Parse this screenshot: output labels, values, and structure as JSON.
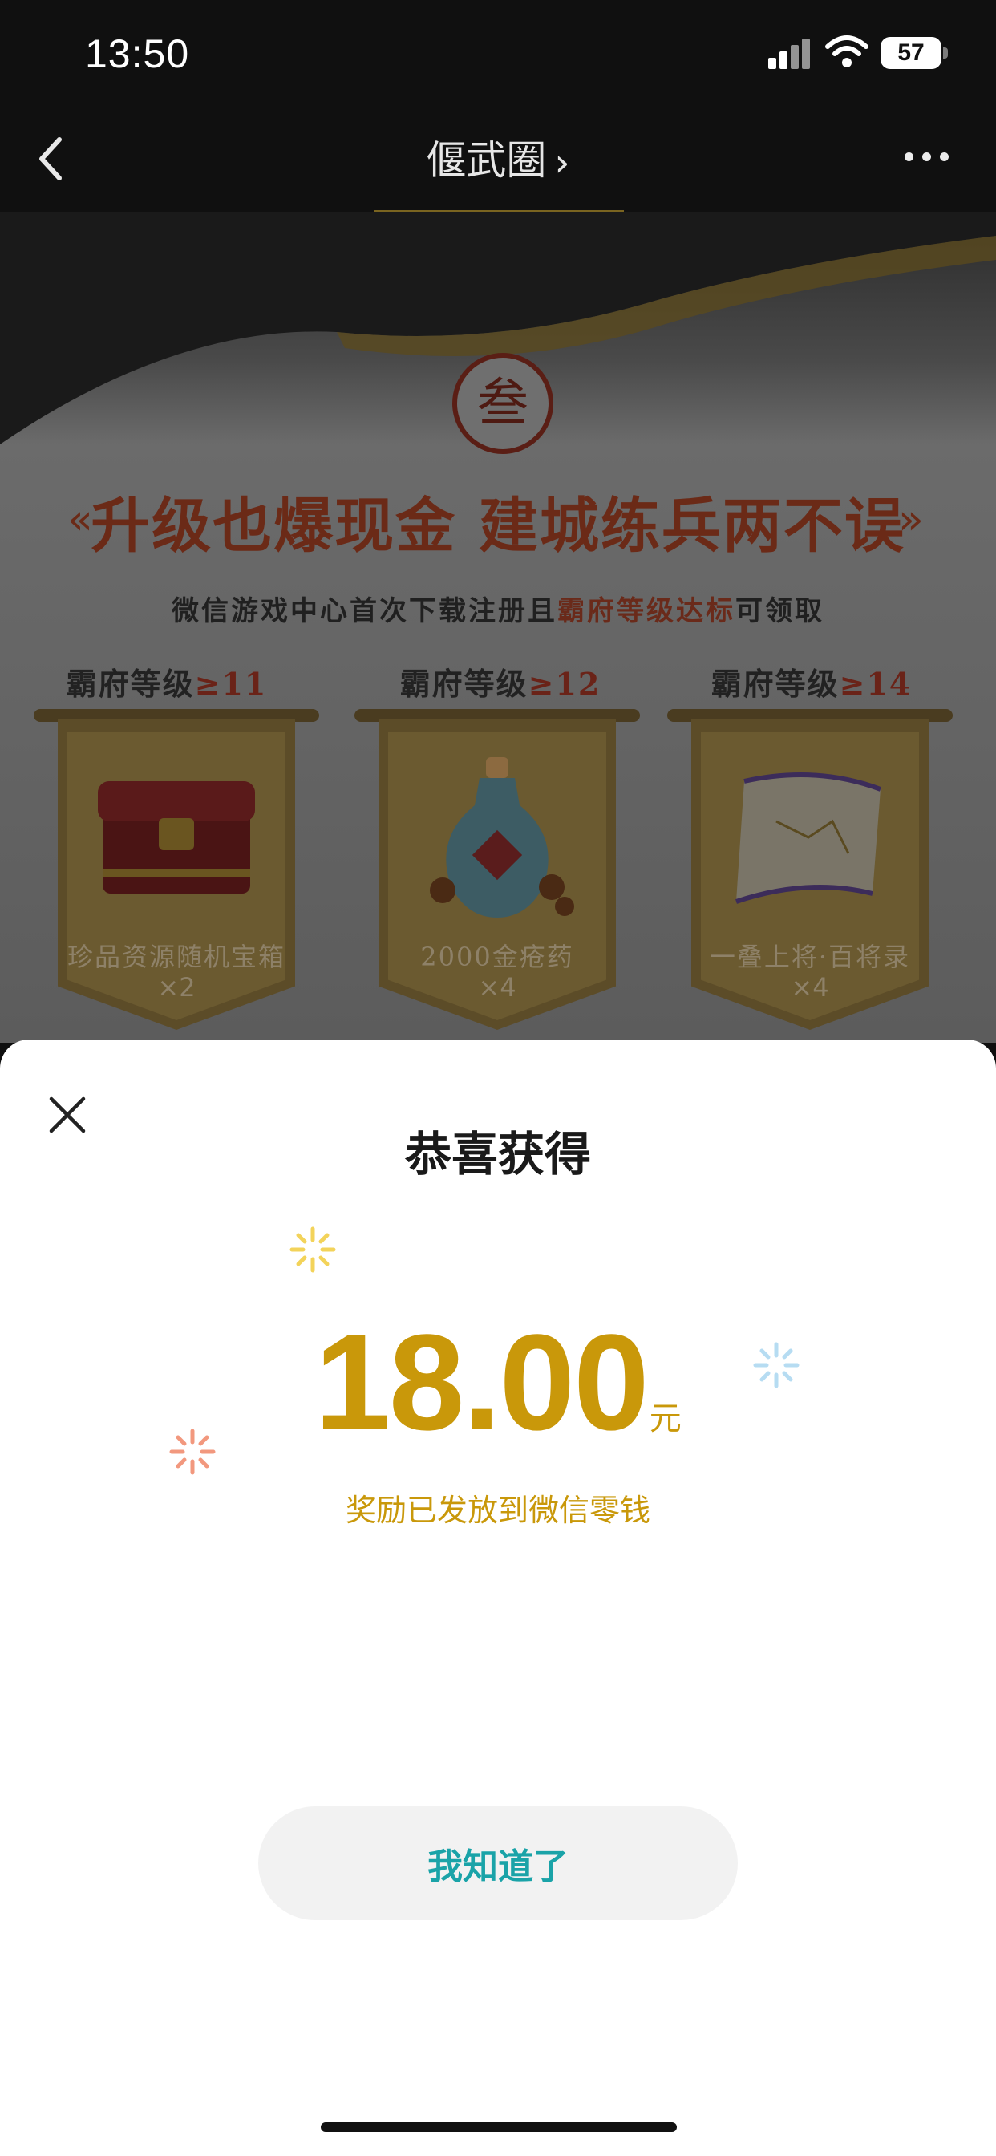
{
  "status_bar": {
    "time": "13:50",
    "battery": "57"
  },
  "nav": {
    "title": "偃武圈",
    "title_chevron": "›"
  },
  "banner": {
    "seal_char": "叁",
    "headline": "升级也爆现金 建城练兵两不误",
    "subline_prefix": "微信游戏中心首次下载注册且",
    "subline_highlight": "霸府等级达标",
    "subline_suffix": "可领取",
    "tiers": [
      {
        "level_label": "霸府等级",
        "level_value": "≥11",
        "reward": "珍品资源随机宝箱",
        "qty": "×2"
      },
      {
        "level_label": "霸府等级",
        "level_value": "≥12",
        "reward": "2000金疮药",
        "qty": "×4"
      },
      {
        "level_label": "霸府等级",
        "level_value": "≥14",
        "reward": "一叠上将·百将录",
        "qty": "×4"
      }
    ]
  },
  "sheet": {
    "title": "恭喜获得",
    "amount": "18.00",
    "unit": "元",
    "note": "奖励已发放到微信零钱",
    "confirm_label": "我知道了"
  },
  "colors": {
    "gold": "#c9980a",
    "teal": "#1aa3a8",
    "crimson": "#6a2318"
  }
}
